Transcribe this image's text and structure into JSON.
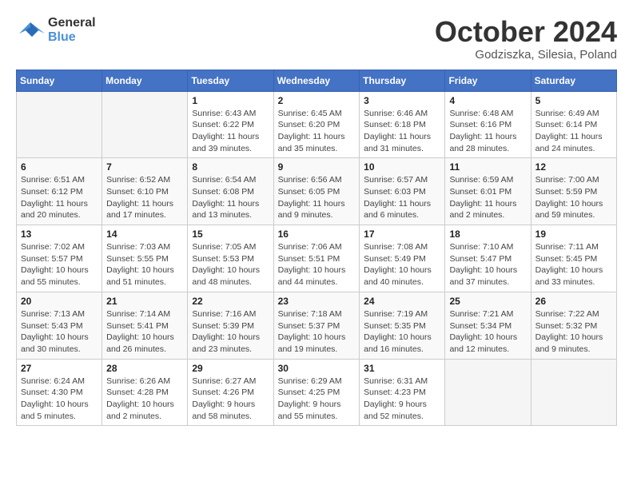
{
  "header": {
    "logo_line1": "General",
    "logo_line2": "Blue",
    "month": "October 2024",
    "location": "Godziszka, Silesia, Poland"
  },
  "weekdays": [
    "Sunday",
    "Monday",
    "Tuesday",
    "Wednesday",
    "Thursday",
    "Friday",
    "Saturday"
  ],
  "weeks": [
    [
      {
        "day": "",
        "sunrise": "",
        "sunset": "",
        "daylight": "",
        "empty": true
      },
      {
        "day": "",
        "sunrise": "",
        "sunset": "",
        "daylight": "",
        "empty": true
      },
      {
        "day": "1",
        "sunrise": "Sunrise: 6:43 AM",
        "sunset": "Sunset: 6:22 PM",
        "daylight": "Daylight: 11 hours and 39 minutes."
      },
      {
        "day": "2",
        "sunrise": "Sunrise: 6:45 AM",
        "sunset": "Sunset: 6:20 PM",
        "daylight": "Daylight: 11 hours and 35 minutes."
      },
      {
        "day": "3",
        "sunrise": "Sunrise: 6:46 AM",
        "sunset": "Sunset: 6:18 PM",
        "daylight": "Daylight: 11 hours and 31 minutes."
      },
      {
        "day": "4",
        "sunrise": "Sunrise: 6:48 AM",
        "sunset": "Sunset: 6:16 PM",
        "daylight": "Daylight: 11 hours and 28 minutes."
      },
      {
        "day": "5",
        "sunrise": "Sunrise: 6:49 AM",
        "sunset": "Sunset: 6:14 PM",
        "daylight": "Daylight: 11 hours and 24 minutes."
      }
    ],
    [
      {
        "day": "6",
        "sunrise": "Sunrise: 6:51 AM",
        "sunset": "Sunset: 6:12 PM",
        "daylight": "Daylight: 11 hours and 20 minutes."
      },
      {
        "day": "7",
        "sunrise": "Sunrise: 6:52 AM",
        "sunset": "Sunset: 6:10 PM",
        "daylight": "Daylight: 11 hours and 17 minutes."
      },
      {
        "day": "8",
        "sunrise": "Sunrise: 6:54 AM",
        "sunset": "Sunset: 6:08 PM",
        "daylight": "Daylight: 11 hours and 13 minutes."
      },
      {
        "day": "9",
        "sunrise": "Sunrise: 6:56 AM",
        "sunset": "Sunset: 6:05 PM",
        "daylight": "Daylight: 11 hours and 9 minutes."
      },
      {
        "day": "10",
        "sunrise": "Sunrise: 6:57 AM",
        "sunset": "Sunset: 6:03 PM",
        "daylight": "Daylight: 11 hours and 6 minutes."
      },
      {
        "day": "11",
        "sunrise": "Sunrise: 6:59 AM",
        "sunset": "Sunset: 6:01 PM",
        "daylight": "Daylight: 11 hours and 2 minutes."
      },
      {
        "day": "12",
        "sunrise": "Sunrise: 7:00 AM",
        "sunset": "Sunset: 5:59 PM",
        "daylight": "Daylight: 10 hours and 59 minutes."
      }
    ],
    [
      {
        "day": "13",
        "sunrise": "Sunrise: 7:02 AM",
        "sunset": "Sunset: 5:57 PM",
        "daylight": "Daylight: 10 hours and 55 minutes."
      },
      {
        "day": "14",
        "sunrise": "Sunrise: 7:03 AM",
        "sunset": "Sunset: 5:55 PM",
        "daylight": "Daylight: 10 hours and 51 minutes."
      },
      {
        "day": "15",
        "sunrise": "Sunrise: 7:05 AM",
        "sunset": "Sunset: 5:53 PM",
        "daylight": "Daylight: 10 hours and 48 minutes."
      },
      {
        "day": "16",
        "sunrise": "Sunrise: 7:06 AM",
        "sunset": "Sunset: 5:51 PM",
        "daylight": "Daylight: 10 hours and 44 minutes."
      },
      {
        "day": "17",
        "sunrise": "Sunrise: 7:08 AM",
        "sunset": "Sunset: 5:49 PM",
        "daylight": "Daylight: 10 hours and 40 minutes."
      },
      {
        "day": "18",
        "sunrise": "Sunrise: 7:10 AM",
        "sunset": "Sunset: 5:47 PM",
        "daylight": "Daylight: 10 hours and 37 minutes."
      },
      {
        "day": "19",
        "sunrise": "Sunrise: 7:11 AM",
        "sunset": "Sunset: 5:45 PM",
        "daylight": "Daylight: 10 hours and 33 minutes."
      }
    ],
    [
      {
        "day": "20",
        "sunrise": "Sunrise: 7:13 AM",
        "sunset": "Sunset: 5:43 PM",
        "daylight": "Daylight: 10 hours and 30 minutes."
      },
      {
        "day": "21",
        "sunrise": "Sunrise: 7:14 AM",
        "sunset": "Sunset: 5:41 PM",
        "daylight": "Daylight: 10 hours and 26 minutes."
      },
      {
        "day": "22",
        "sunrise": "Sunrise: 7:16 AM",
        "sunset": "Sunset: 5:39 PM",
        "daylight": "Daylight: 10 hours and 23 minutes."
      },
      {
        "day": "23",
        "sunrise": "Sunrise: 7:18 AM",
        "sunset": "Sunset: 5:37 PM",
        "daylight": "Daylight: 10 hours and 19 minutes."
      },
      {
        "day": "24",
        "sunrise": "Sunrise: 7:19 AM",
        "sunset": "Sunset: 5:35 PM",
        "daylight": "Daylight: 10 hours and 16 minutes."
      },
      {
        "day": "25",
        "sunrise": "Sunrise: 7:21 AM",
        "sunset": "Sunset: 5:34 PM",
        "daylight": "Daylight: 10 hours and 12 minutes."
      },
      {
        "day": "26",
        "sunrise": "Sunrise: 7:22 AM",
        "sunset": "Sunset: 5:32 PM",
        "daylight": "Daylight: 10 hours and 9 minutes."
      }
    ],
    [
      {
        "day": "27",
        "sunrise": "Sunrise: 6:24 AM",
        "sunset": "Sunset: 4:30 PM",
        "daylight": "Daylight: 10 hours and 5 minutes."
      },
      {
        "day": "28",
        "sunrise": "Sunrise: 6:26 AM",
        "sunset": "Sunset: 4:28 PM",
        "daylight": "Daylight: 10 hours and 2 minutes."
      },
      {
        "day": "29",
        "sunrise": "Sunrise: 6:27 AM",
        "sunset": "Sunset: 4:26 PM",
        "daylight": "Daylight: 9 hours and 58 minutes."
      },
      {
        "day": "30",
        "sunrise": "Sunrise: 6:29 AM",
        "sunset": "Sunset: 4:25 PM",
        "daylight": "Daylight: 9 hours and 55 minutes."
      },
      {
        "day": "31",
        "sunrise": "Sunrise: 6:31 AM",
        "sunset": "Sunset: 4:23 PM",
        "daylight": "Daylight: 9 hours and 52 minutes."
      },
      {
        "day": "",
        "sunrise": "",
        "sunset": "",
        "daylight": "",
        "empty": true
      },
      {
        "day": "",
        "sunrise": "",
        "sunset": "",
        "daylight": "",
        "empty": true
      }
    ]
  ]
}
